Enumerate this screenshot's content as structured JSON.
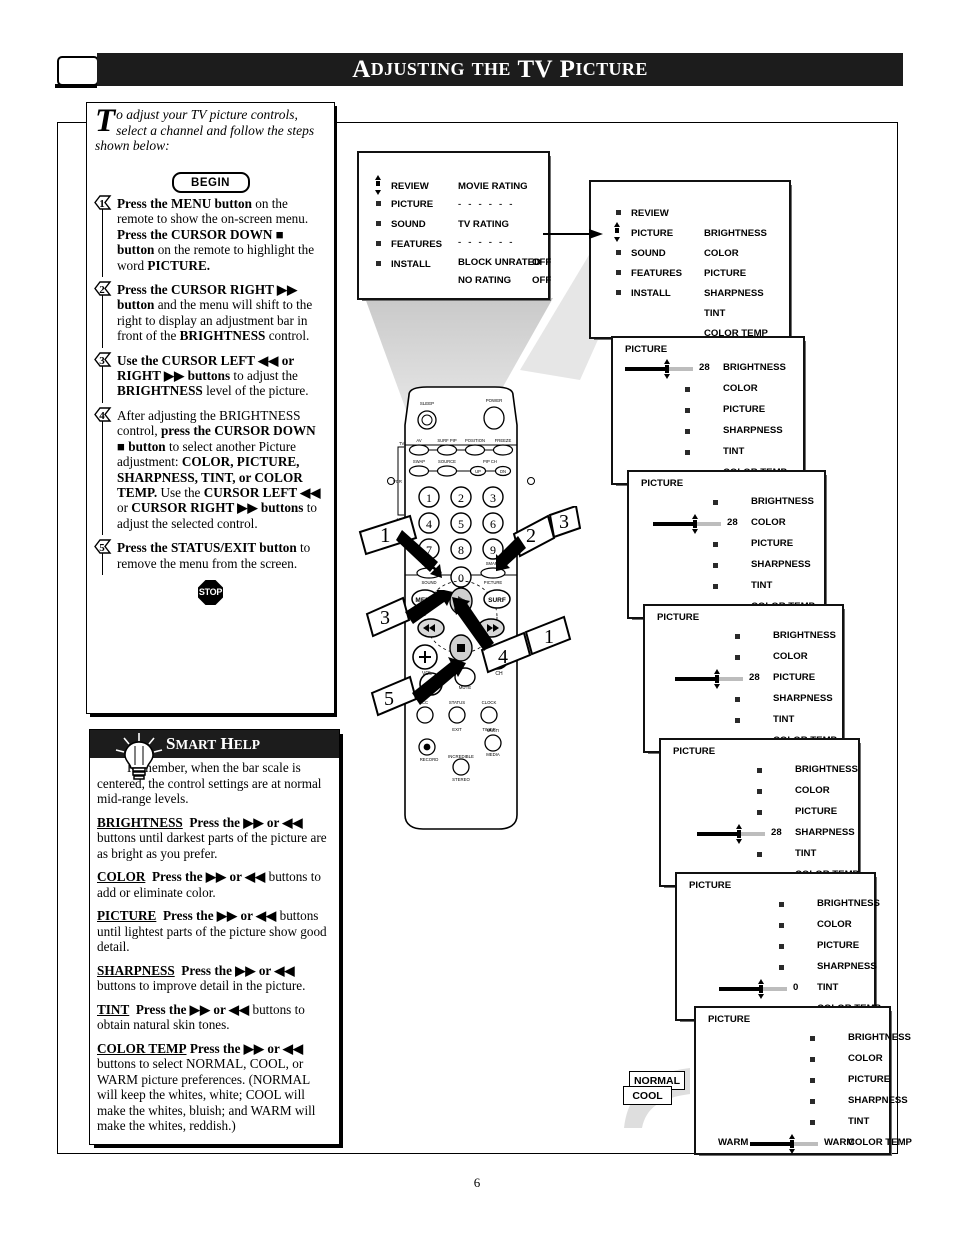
{
  "header": {
    "title_parts": [
      "A",
      "DJUSTING",
      "THE",
      "TV",
      "P",
      "ICTURE"
    ],
    "title": "ADJUSTING THE TV PICTURE"
  },
  "intro": {
    "dropcap": "T",
    "text": "o adjust your TV picture controls, select a channel and follow the steps shown below:"
  },
  "begin_label": "BEGIN",
  "stop_label": "STOP",
  "steps": [
    {
      "num": "1",
      "html": "<b>Press the MENU button</b> on the remote to show the on-screen menu. <b>Press the CURSOR DOWN ■ button</b> on the remote to highlight the word <b>PICTURE.</b>"
    },
    {
      "num": "2",
      "html": "<b>Press the CURSOR RIGHT ▶▶ button</b> and the menu will shift to the right to display an adjustment bar in front of the <b>BRIGHTNESS</b> control."
    },
    {
      "num": "3",
      "html": "<b>Use the CURSOR LEFT ◀◀ or RIGHT ▶▶ buttons</b> to adjust the <b>BRIGHTNESS</b> level of the picture."
    },
    {
      "num": "4",
      "html": "After adjusting the BRIGHTNESS control, <b>press the CURSOR DOWN ■ button</b> to select another Picture adjustment: <b>COLOR, PICTURE, SHARPNESS, TINT, or COLOR TEMP.</b> Use the <b>CURSOR LEFT ◀◀</b> or <b>CURSOR RIGHT ▶▶ buttons</b> to adjust the selected control."
    },
    {
      "num": "5",
      "html": "<b>Press the STATUS/EXIT button</b> to remove the menu from the screen."
    }
  ],
  "smart_help": {
    "title_parts": [
      "S",
      "MART",
      "H",
      "ELP"
    ],
    "title": "SMART HELP",
    "paragraphs": [
      {
        "html": "Remember, when the bar scale is centered, the control settings are at normal mid-range levels.",
        "indent": true
      },
      {
        "html": "<u>BRIGHTNESS</u>&nbsp; <b>Press the ▶▶ or ◀◀</b> buttons until darkest parts of the picture are as bright as you prefer."
      },
      {
        "html": "<u>COLOR</u>&nbsp; <b>Press the ▶▶ or ◀◀</b> buttons to add or eliminate color."
      },
      {
        "html": "<u>PICTURE</u>&nbsp; <b>Press the ▶▶ or ◀◀</b> buttons until lightest parts of the picture show good detail."
      },
      {
        "html": "<u>SHARPNESS</u>&nbsp; <b>Press the ▶▶ or ◀◀</b> buttons to improve detail in the picture."
      },
      {
        "html": "<u>TINT</u>&nbsp; <b>Press the ▶▶ or ◀◀</b> buttons to obtain natural skin tones."
      },
      {
        "html": "<u>COLOR TEMP</u> <b>Press the ▶▶ or ◀◀</b> buttons to select NORMAL, COOL, or WARM picture preferences. (NORMAL will keep the whites, white; COOL will make the whites, bluish; and WARM will make the whites, reddish.)"
      }
    ]
  },
  "osd": {
    "main_menu_items": [
      "REVIEW",
      "PICTURE",
      "SOUND",
      "FEATURES",
      "INSTALL"
    ],
    "picture_items": [
      "BRIGHTNESS",
      "COLOR",
      "PICTURE",
      "SHARPNESS",
      "TINT",
      "COLOR TEMP"
    ],
    "panel1": {
      "left_items": [
        "REVIEW",
        "PICTURE",
        "SOUND",
        "FEATURES",
        "INSTALL"
      ],
      "right_rows": [
        {
          "label": "MOVIE RATING",
          "value": ""
        },
        {
          "label": "- - - - - -",
          "value": ""
        },
        {
          "label": "TV RATING",
          "value": ""
        },
        {
          "label": "- - - - - -",
          "value": ""
        },
        {
          "label": "BLOCK UNRATED",
          "value": "OFF"
        },
        {
          "label": "NO RATING",
          "value": "OFF"
        }
      ]
    },
    "panel2": {
      "title": "",
      "highlight": "PICTURE"
    },
    "panel3": {
      "title": "PICTURE",
      "selected": "BRIGHTNESS",
      "value": "28"
    },
    "panel4": {
      "title": "PICTURE",
      "selected": "COLOR",
      "value": "28"
    },
    "panel5": {
      "title": "PICTURE",
      "selected": "PICTURE",
      "value": "28"
    },
    "panel6": {
      "title": "PICTURE",
      "selected": "SHARPNESS",
      "value": "28"
    },
    "panel7": {
      "title": "PICTURE",
      "selected": "TINT",
      "value": "0"
    },
    "panel8": {
      "title": "PICTURE",
      "selected": "COLOR TEMP",
      "value": "WARM",
      "options": [
        "NORMAL",
        "COOL",
        "WARM"
      ]
    }
  },
  "remote": {
    "buttons": [
      "SLEEP",
      "POWER",
      "AV",
      "SURF PIP",
      "POSITION",
      "FREEZE",
      "SWAP",
      "SOURCE",
      "PIP CH",
      "UP",
      "DN",
      "1",
      "2",
      "3",
      "4",
      "5",
      "6",
      "7",
      "8",
      "9",
      "0",
      "SMART SOUND",
      "SMART PICTURE",
      "MENU",
      "SURF",
      "VOL",
      "CH",
      "MUTE",
      "CC",
      "STATUS/EXIT",
      "CLOCK/TIMER",
      "RECORD",
      "MULTI MEDIA",
      "INCREDIBLE STEREO"
    ],
    "side_labels": [
      "TV",
      "VCR",
      "ACC"
    ]
  },
  "callouts": [
    {
      "num": "1",
      "target": "menu-button"
    },
    {
      "num": "2",
      "target": "cursor-right-button"
    },
    {
      "num": "3",
      "target": "cursor-right-button"
    },
    {
      "num": "3",
      "target": "cursor-left-button"
    },
    {
      "num": "4",
      "target": "cursor-down-button"
    },
    {
      "num": "1",
      "target": "cursor-down-button"
    },
    {
      "num": "5",
      "target": "status-exit-button"
    }
  ],
  "page_number": "6",
  "colors": {
    "ink": "#000000",
    "header_bg": "#1c1c1c",
    "shadow": "#6f6f6f",
    "bar_track": "#bdbdbd",
    "cone": "#d4d4d4"
  }
}
